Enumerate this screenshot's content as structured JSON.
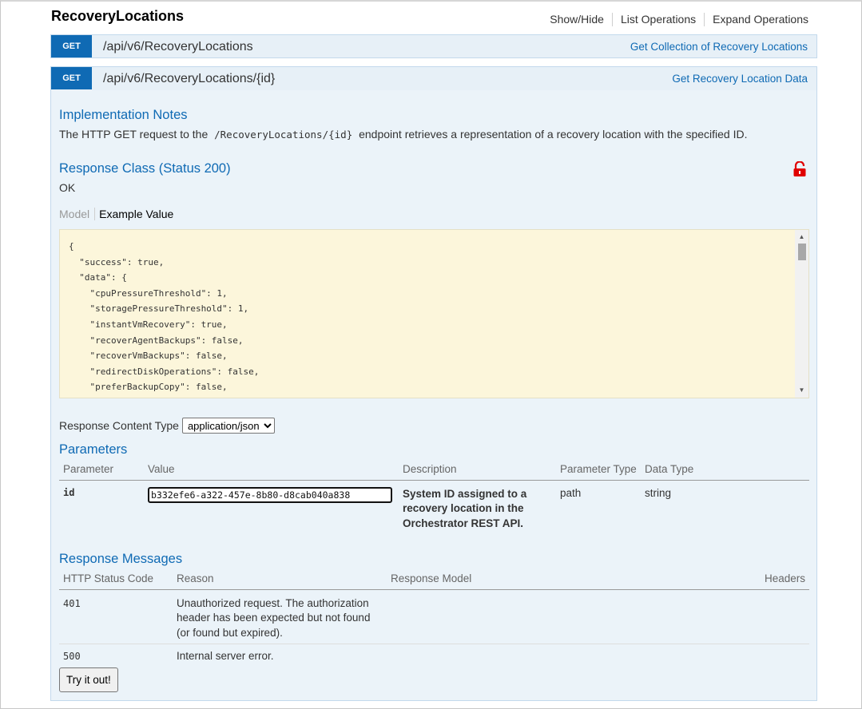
{
  "resource": {
    "title": "RecoveryLocations",
    "links": [
      "Show/Hide",
      "List Operations",
      "Expand Operations"
    ]
  },
  "operations": [
    {
      "method": "GET",
      "path": "/api/v6/RecoveryLocations",
      "summary": "Get Collection of Recovery Locations"
    },
    {
      "method": "GET",
      "path": "/api/v6/RecoveryLocations/{id}",
      "summary": "Get Recovery Location Data"
    }
  ],
  "implementation": {
    "heading": "Implementation Notes",
    "text_before": "The HTTP GET request to the",
    "code": "/RecoveryLocations/{id}",
    "text_after": "endpoint retrieves a representation of a recovery location with the specified ID."
  },
  "response_class": {
    "heading": "Response Class (Status 200)",
    "value": "OK",
    "lock_icon": "unlocked-padlock-icon",
    "lock_color": "#e00000",
    "tabs": {
      "model": "Model",
      "example": "Example Value"
    },
    "sample": "{\n  \"success\": true,\n  \"data\": {\n    \"cpuPressureThreshold\": 1,\n    \"storagePressureThreshold\": 1,\n    \"instantVmRecovery\": true,\n    \"recoverAgentBackups\": false,\n    \"recoverVmBackups\": false,\n    \"redirectDiskOperations\": false,\n    \"preferBackupCopy\": false,"
  },
  "content_type": {
    "label": "Response Content Type",
    "selected": "application/json"
  },
  "parameters": {
    "heading": "Parameters",
    "headers": [
      "Parameter",
      "Value",
      "Description",
      "Parameter Type",
      "Data Type"
    ],
    "rows": [
      {
        "name": "id",
        "value": "b332efe6-a322-457e-8b80-d8cab040a838",
        "description": "System ID assigned to a recovery location in the Orchestrator REST API.",
        "param_type": "path",
        "data_type": "string"
      }
    ]
  },
  "response_messages": {
    "heading": "Response Messages",
    "headers": [
      "HTTP Status Code",
      "Reason",
      "Response Model",
      "Headers"
    ],
    "rows": [
      {
        "code": "401",
        "reason": "Unauthorized request. The authorization header has been expected but not found (or found but expired)."
      },
      {
        "code": "500",
        "reason": "Internal server error."
      }
    ]
  },
  "try_button": "Try it out!",
  "colors": {
    "accent": "#0f6ab4",
    "get_verb_bg": "#0f6ab4",
    "op_bg": "#e7f0f7",
    "sample_bg": "#fcf6db"
  }
}
